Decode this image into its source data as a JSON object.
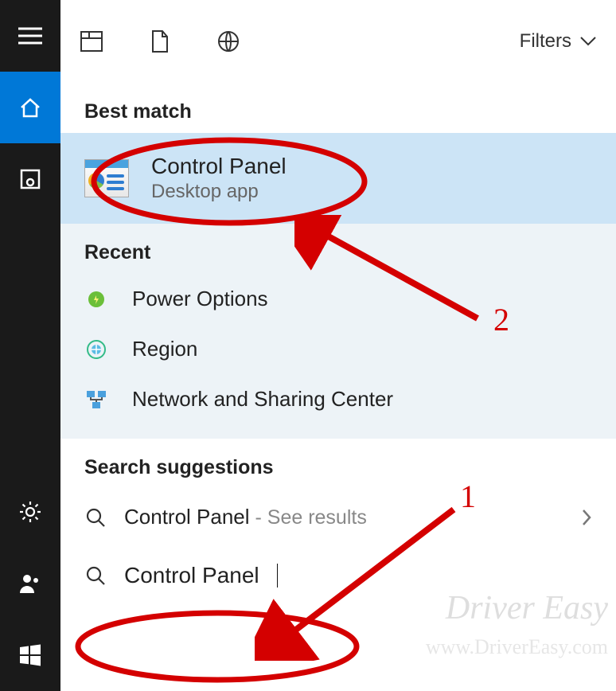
{
  "topbar": {
    "filters_label": "Filters"
  },
  "sections": {
    "best_match_label": "Best match",
    "recent_label": "Recent",
    "suggestions_label": "Search suggestions"
  },
  "best_match": {
    "title": "Control Panel",
    "subtitle": "Desktop app"
  },
  "recent": [
    {
      "label": "Power Options",
      "icon": "power"
    },
    {
      "label": "Region",
      "icon": "region"
    },
    {
      "label": "Network and Sharing Center",
      "icon": "network"
    }
  ],
  "suggestion": {
    "term": "Control Panel",
    "hint_prefix": " - See",
    "hint_suffix": " results"
  },
  "search": {
    "value": "Control Panel"
  },
  "annotations": {
    "step1": "1",
    "step2": "2"
  },
  "watermark": {
    "line1": "Driver Easy",
    "line2": "www.DriverEasy.com"
  }
}
